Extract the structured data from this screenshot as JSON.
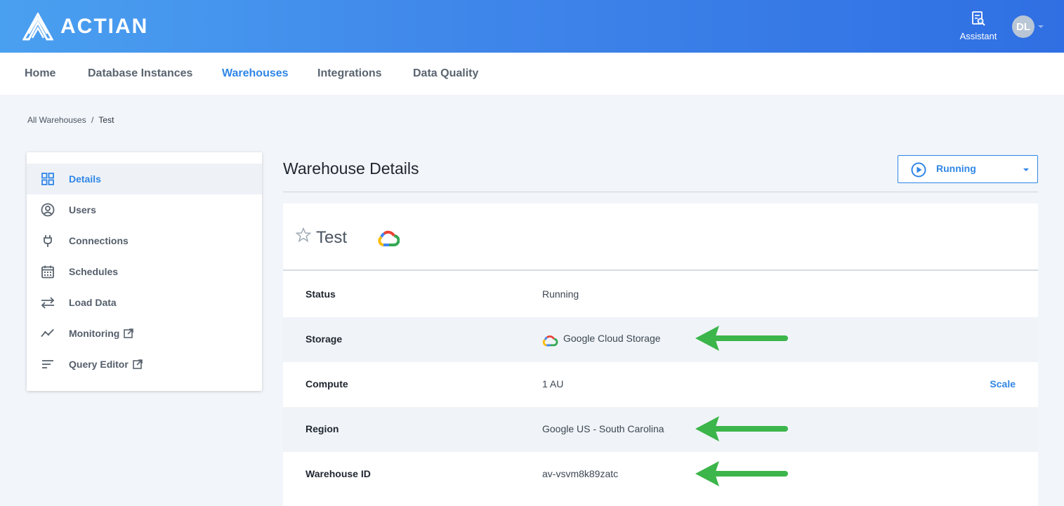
{
  "app": {
    "brand": "ACTIAN",
    "accent_color": "#2f86e6",
    "arrow_color": "#3cb54a"
  },
  "header": {
    "assistant_label": "Assistant",
    "assistant_icon": "assistant-search-icon",
    "avatar_initials": "DL"
  },
  "nav": {
    "items": [
      {
        "label": "Home",
        "active": false
      },
      {
        "label": "Database Instances",
        "active": false
      },
      {
        "label": "Warehouses",
        "active": true
      },
      {
        "label": "Integrations",
        "active": false
      },
      {
        "label": "Data Quality",
        "active": false
      }
    ]
  },
  "breadcrumb": {
    "parent": "All Warehouses",
    "separator": "/",
    "current": "Test"
  },
  "sidebar": {
    "items": [
      {
        "label": "Details",
        "icon": "grid-icon",
        "active": true,
        "external": false
      },
      {
        "label": "Users",
        "icon": "user-circle-icon",
        "active": false,
        "external": false
      },
      {
        "label": "Connections",
        "icon": "plug-icon",
        "active": false,
        "external": false
      },
      {
        "label": "Schedules",
        "icon": "calendar-icon",
        "active": false,
        "external": false
      },
      {
        "label": "Load Data",
        "icon": "swap-arrows-icon",
        "active": false,
        "external": false
      },
      {
        "label": "Monitoring",
        "icon": "trend-line-icon",
        "active": false,
        "external": true
      },
      {
        "label": "Query Editor",
        "icon": "lines-icon",
        "active": false,
        "external": true
      }
    ]
  },
  "main": {
    "title": "Warehouse Details",
    "status_select": {
      "value": "Running",
      "icon": "play-circle-icon"
    },
    "warehouse": {
      "name": "Test",
      "provider_icon": "google-cloud-icon",
      "favorite_icon": "star-outline-icon"
    },
    "details": [
      {
        "key": "Status",
        "value": "Running"
      },
      {
        "key": "Storage",
        "value": "Google Cloud Storage"
      },
      {
        "key": "Compute",
        "value": "1 AU",
        "action": "Scale"
      },
      {
        "key": "Region",
        "value": "Google US - South Carolina"
      },
      {
        "key": "Warehouse ID",
        "value": "av-vsvm8k89zatc"
      }
    ]
  }
}
